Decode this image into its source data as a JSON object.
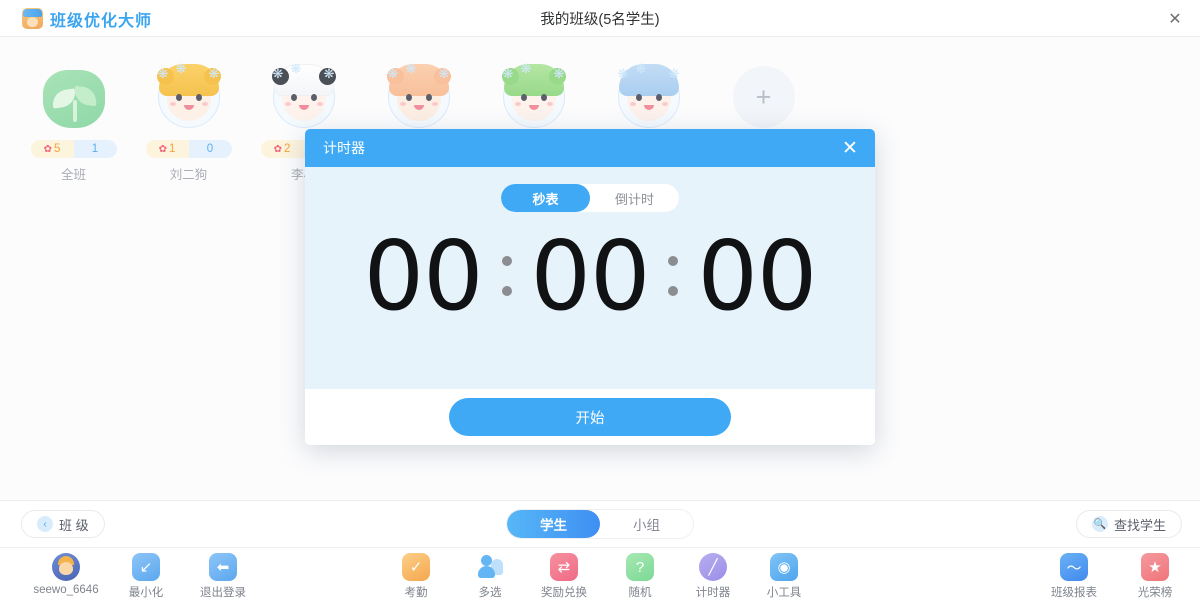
{
  "titlebar": {
    "brand": "班级优化大师",
    "window_title": "我的班级(5名学生)",
    "close_icon": "close-icon"
  },
  "students": [
    {
      "name": "全班",
      "positive": "5",
      "negative": "1",
      "type": "class"
    },
    {
      "name": "刘二狗",
      "positive": "1",
      "negative": "0",
      "type": "tiger"
    },
    {
      "name": "李小",
      "positive": "2",
      "negative": "",
      "type": "panda"
    },
    {
      "name": "",
      "positive": "",
      "negative": "",
      "type": "deer"
    },
    {
      "name": "",
      "positive": "",
      "negative": "",
      "type": "frog"
    },
    {
      "name": "",
      "positive": "",
      "negative": "",
      "type": "bluehair"
    }
  ],
  "add_student": {
    "label": "+"
  },
  "modal": {
    "title": "计时器",
    "close_icon": "close-icon",
    "tabs": [
      {
        "label": "秒表",
        "active": true
      },
      {
        "label": "倒计时",
        "active": false
      }
    ],
    "time": {
      "hours": "00",
      "minutes": "00",
      "seconds": "00"
    },
    "start_label": "开始"
  },
  "subbar": {
    "class_button": "班 级",
    "class_icon": "chevron-left-icon",
    "find_button": "查找学生",
    "find_icon": "search-icon",
    "tabs": [
      {
        "label": "学生",
        "active": true
      },
      {
        "label": "小组",
        "active": false
      }
    ]
  },
  "toolbar": {
    "left": [
      {
        "label": "seewo_6646",
        "icon": "user-avatar-icon"
      },
      {
        "label": "最小化",
        "icon": "minimize-icon"
      },
      {
        "label": "退出登录",
        "icon": "logout-icon"
      }
    ],
    "center": [
      {
        "label": "考勤",
        "icon": "check-icon"
      },
      {
        "label": "多选",
        "icon": "multi-select-icon"
      },
      {
        "label": "奖励兑换",
        "icon": "gift-icon"
      },
      {
        "label": "随机",
        "icon": "question-icon"
      },
      {
        "label": "计时器",
        "icon": "timer-icon"
      },
      {
        "label": "小工具",
        "icon": "toolbox-icon"
      }
    ],
    "right": [
      {
        "label": "班级报表",
        "icon": "chart-icon"
      },
      {
        "label": "光荣榜",
        "icon": "star-badge-icon"
      }
    ]
  },
  "colors": {
    "brand_blue": "#3fa9f5",
    "modal_body": "#e6f3fb",
    "badge_positive_bg": "#fdf4dd",
    "badge_negative_bg": "#e5f2fd"
  }
}
